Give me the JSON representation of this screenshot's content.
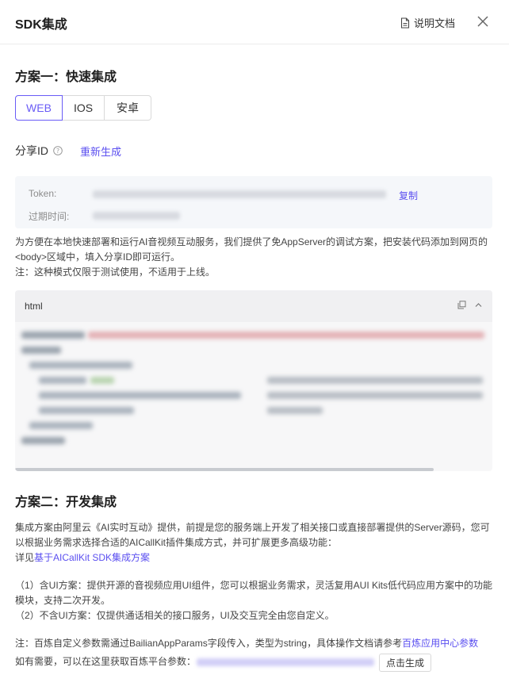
{
  "header": {
    "title": "SDK集成",
    "doc_label": "说明文档"
  },
  "plan1": {
    "title": "方案一：快速集成",
    "tabs": [
      {
        "label": "WEB",
        "active": true
      },
      {
        "label": "IOS",
        "active": false
      },
      {
        "label": "安卓",
        "active": false
      }
    ],
    "share_id_label": "分享ID",
    "regenerate_label": "重新生成",
    "token_label": "Token:",
    "expire_label": "过期时间:",
    "copy_label": "复制",
    "desc_line1": "为方便在本地快速部署和运行AI音视频互动服务，我们提供了免AppServer的调试方案，把安装代码添加到网页的",
    "desc_line2": "<body>区域中，填入分享ID即可运行。",
    "note": "注：这种模式仅限于测试使用，不适用于上线。",
    "code_lang": "html"
  },
  "plan2": {
    "title": "方案二：开发集成",
    "desc_line1": "集成方案由阿里云《AI实时互动》提供，前提是您的服务端上开发了相关接口或直接部署提供的Server源码，您可",
    "desc_line2": "以根据业务需求选择合适的AICallKit插件集成方式，并可扩展更多高级功能：",
    "detail_prefix": "详见",
    "detail_link": "基于AICallKit SDK集成方案",
    "item1_line1": "（1）含UI方案：提供开源的音视频应用UI组件，您可以根据业务需求，灵活复用AUI Kits低代码应用方案中的功能",
    "item1_line2": "模块，支持二次开发。",
    "item2": "（2）不含UI方案：仅提供通话相关的接口服务，UI及交互完全由您自定义。",
    "note_prefix": "注：百炼自定义参数需通过BailianAppParams字段传入，类型为string，具体操作文档请参考",
    "note_link": "百炼应用中心参数",
    "fetch_label": "如有需要，可以在这里获取百炼平台参数：",
    "generate_label": "点击生成"
  },
  "colors": {
    "accent": "#5b4ff0",
    "border": "#d9d9d9"
  }
}
